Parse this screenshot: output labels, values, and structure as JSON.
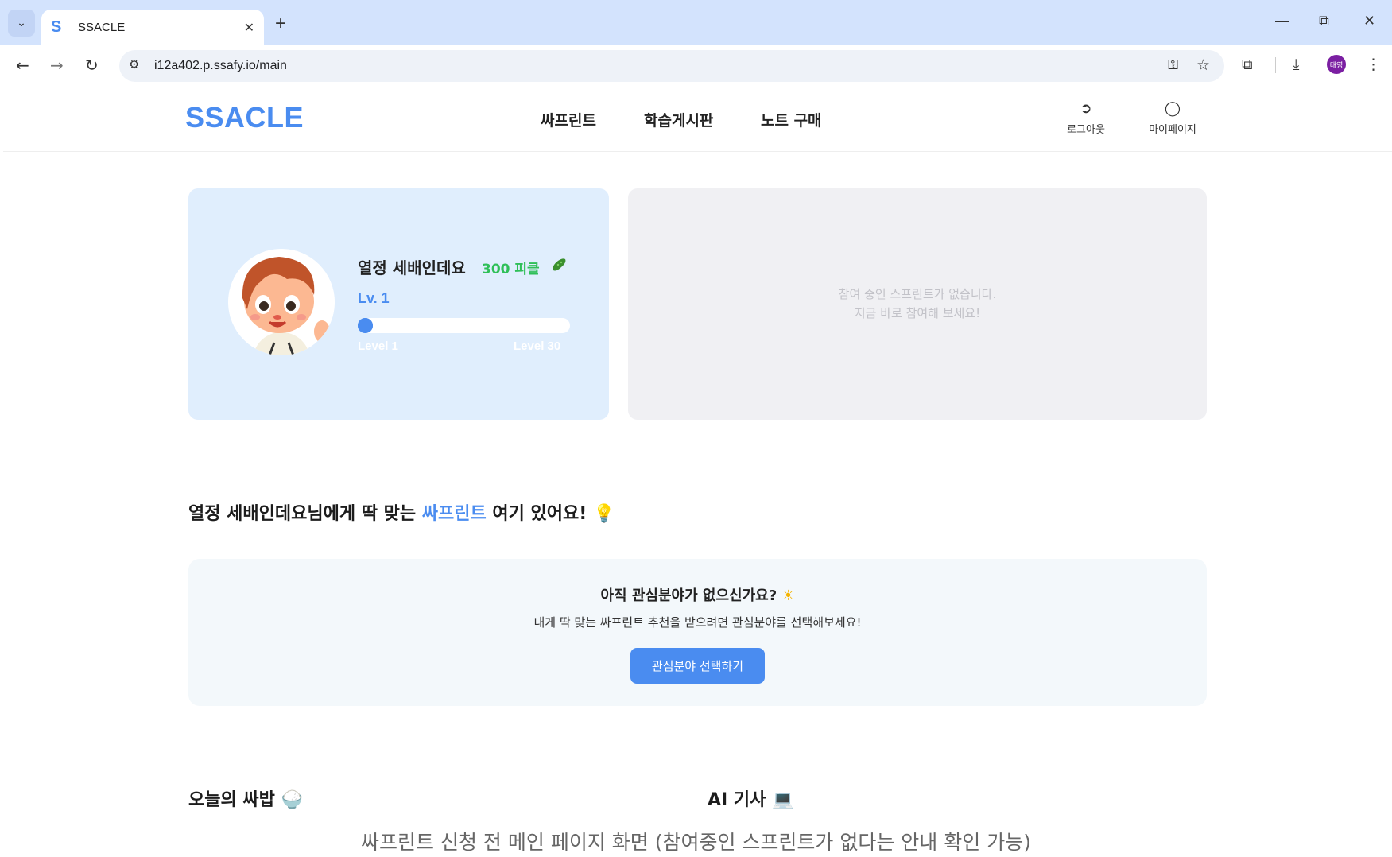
{
  "browser": {
    "tab_title": "SSACLE",
    "tab_favicon": "S",
    "url": "i12a402.p.ssafy.io/main",
    "profile_initials": "태영",
    "icons": [
      "tab-search-icon",
      "close-icon",
      "new-tab-icon",
      "minimize-icon",
      "restore-icon",
      "window-close-icon",
      "back-icon",
      "forward-icon",
      "reload-icon",
      "site-info-icon",
      "password-key-icon",
      "bookmark-star-icon",
      "extensions-icon",
      "download-icon",
      "menu-icon"
    ]
  },
  "header": {
    "logo": "SSACLE",
    "nav": [
      "싸프린트",
      "학습게시판",
      "노트 구매"
    ],
    "logout_label": "로그아웃",
    "mypage_label": "마이페이지"
  },
  "profile": {
    "name": "열정 세배인데요",
    "points": "300 피클",
    "level_label": "Lv. 1",
    "level_min": "Level 1",
    "level_max": "Level 30",
    "level_progress": 0.0
  },
  "sprint": {
    "empty_line1": "참여 중인 스프린트가 없습니다.",
    "empty_line2": "지금 바로 참여해 보세요!"
  },
  "recommend": {
    "title_prefix": "열정 세배인데요님에게 딱 맞는 ",
    "title_accent": "싸프린트",
    "title_suffix": " 여기 있어요!",
    "title_emoji": "💡",
    "question": "아직 관심분야가 없으신가요?",
    "question_emoji": "☀",
    "description": "내게 딱 맞는 싸프린트 추천을 받으려면 관심분야를 선택해보세요!",
    "button_label": "관심분야 선택하기"
  },
  "sections": {
    "meal_title": "오늘의 싸밥",
    "meal_emoji": "🍚",
    "ai_title": "AI 기사",
    "ai_emoji": "💻"
  },
  "caption": "싸프린트 신청 전 메인 페이지 화면 (참여중인 스프린트가 없다는 안내 확인 가능)",
  "colors": {
    "brand_blue": "#4a8cf0",
    "pickle_green": "#2fbf58",
    "profile_card_bg": "#e0eefd",
    "sprint_card_bg": "#f0f0f3",
    "reco_card_bg": "#f3f8fb"
  }
}
